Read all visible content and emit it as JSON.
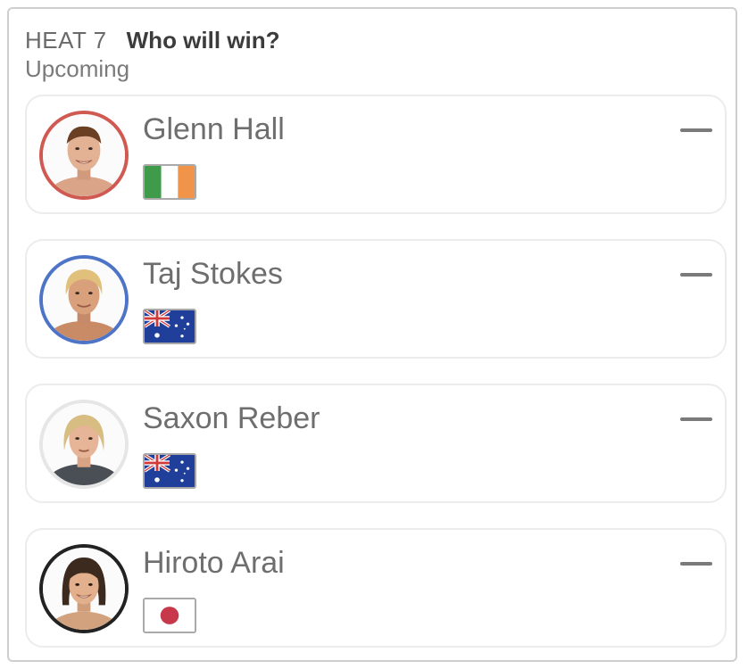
{
  "header": {
    "heat": "HEAT 7",
    "question": "Who will win?",
    "status": "Upcoming"
  },
  "colors": {
    "ring_red": "#d05a52",
    "ring_blue": "#4e74c8",
    "ring_light": "#e6e6e6",
    "ring_dark": "#222222"
  },
  "surfers": [
    {
      "name": "Glenn Hall",
      "flag_icon": "ireland-flag-icon",
      "ring": "red",
      "prediction": "—"
    },
    {
      "name": "Taj Stokes",
      "flag_icon": "australia-flag-icon",
      "ring": "blue",
      "prediction": "—"
    },
    {
      "name": "Saxon Reber",
      "flag_icon": "australia-flag-icon",
      "ring": "light",
      "prediction": "—"
    },
    {
      "name": "Hiroto Arai",
      "flag_icon": "japan-flag-icon",
      "ring": "dark",
      "prediction": "—"
    }
  ]
}
